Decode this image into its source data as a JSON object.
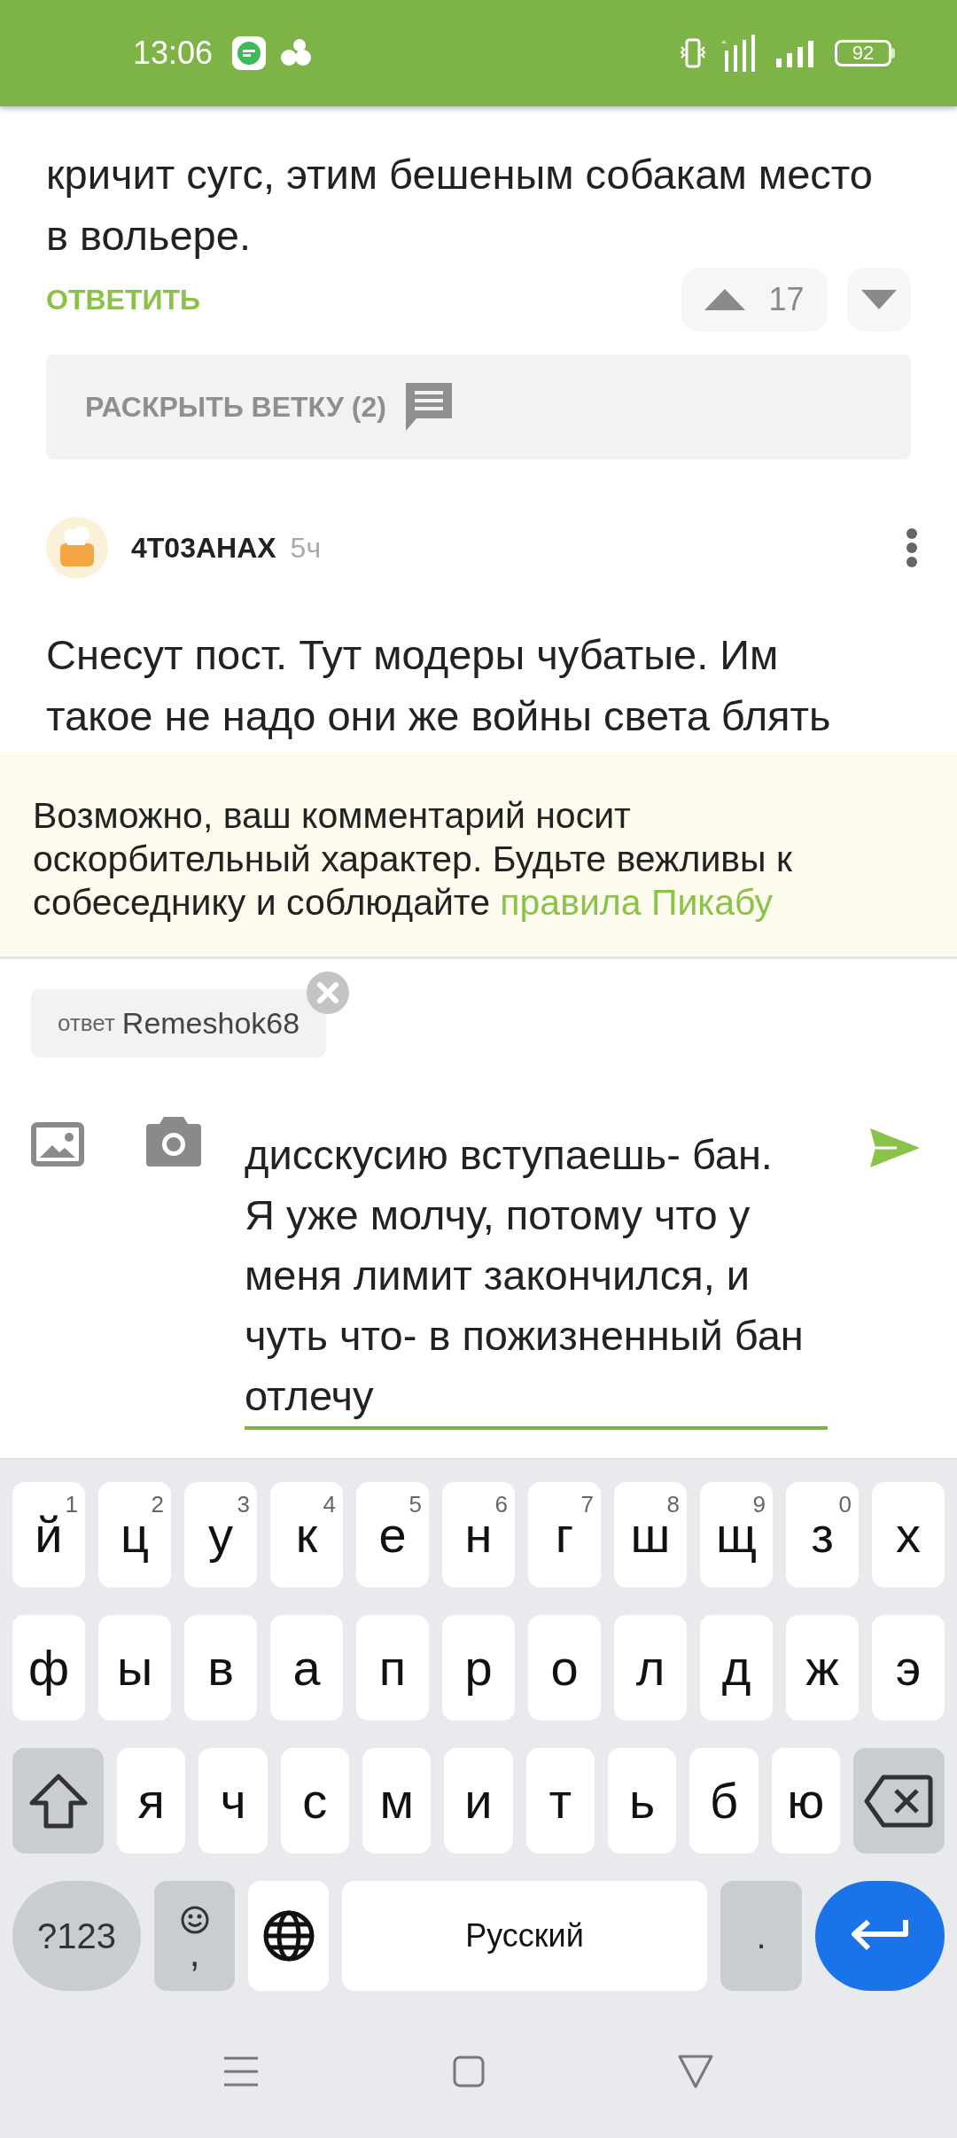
{
  "status_bar": {
    "time": "13:06",
    "battery": "92"
  },
  "previous_comment": {
    "text_lines": [
      "кричит сугс, этим бешеным собакам место",
      "в вольере."
    ],
    "reply_label": "ОТВЕТИТЬ",
    "score": "17",
    "expand_label": "РАСКРЫТЬ ВЕТКУ (2)"
  },
  "comment": {
    "author": "4T03AHAX",
    "age": "5ч",
    "text_lines": [
      "Снесут пост. Тут модеры чубатые. Им",
      "такое не надо они же войны света блять"
    ]
  },
  "warning": {
    "lines": [
      "Возможно, ваш комментарий носит",
      "оскорбительный характер. Будьте вежливы к",
      "собеседнику и соблюдайте "
    ],
    "link": "правила Пикабу"
  },
  "reply_chip": {
    "prefix": "ответ",
    "user": "Remeshok68"
  },
  "composer": {
    "value_lines": [
      "дисскусию вступаешь- бан.",
      "Я уже молчу, потому что у",
      "меня лимит закончился, и",
      "чуть что- в пожизненный бан",
      "отлечу"
    ]
  },
  "keyboard": {
    "row_1": [
      {
        "kind": "letter",
        "label": "й",
        "hint": "1"
      },
      {
        "kind": "letter",
        "label": "ц",
        "hint": "2"
      },
      {
        "kind": "letter",
        "label": "у",
        "hint": "3"
      },
      {
        "kind": "letter",
        "label": "к",
        "hint": "4"
      },
      {
        "kind": "letter",
        "label": "е",
        "hint": "5"
      },
      {
        "kind": "letter",
        "label": "н",
        "hint": "6"
      },
      {
        "kind": "letter",
        "label": "г",
        "hint": "7"
      },
      {
        "kind": "letter",
        "label": "ш",
        "hint": "8"
      },
      {
        "kind": "letter",
        "label": "щ",
        "hint": "9"
      },
      {
        "kind": "letter",
        "label": "з",
        "hint": "0"
      },
      {
        "kind": "letter",
        "label": "х"
      }
    ],
    "row_2": [
      {
        "kind": "letter",
        "label": "ф"
      },
      {
        "kind": "letter",
        "label": "ы"
      },
      {
        "kind": "letter",
        "label": "в"
      },
      {
        "kind": "letter",
        "label": "а"
      },
      {
        "kind": "letter",
        "label": "п"
      },
      {
        "kind": "letter",
        "label": "р"
      },
      {
        "kind": "letter",
        "label": "о"
      },
      {
        "kind": "letter",
        "label": "л"
      },
      {
        "kind": "letter",
        "label": "д"
      },
      {
        "kind": "letter",
        "label": "ж"
      },
      {
        "kind": "letter",
        "label": "э"
      }
    ],
    "row_3": [
      {
        "kind": "shift"
      },
      {
        "kind": "letter",
        "label": "я"
      },
      {
        "kind": "letter",
        "label": "ч"
      },
      {
        "kind": "letter",
        "label": "с"
      },
      {
        "kind": "letter",
        "label": "м"
      },
      {
        "kind": "letter",
        "label": "и"
      },
      {
        "kind": "letter",
        "label": "т"
      },
      {
        "kind": "letter",
        "label": "ь"
      },
      {
        "kind": "letter",
        "label": "б"
      },
      {
        "kind": "letter",
        "label": "ю"
      },
      {
        "kind": "backspace"
      }
    ],
    "bottom_row": [
      {
        "kind": "symbols",
        "label": "?123"
      },
      {
        "kind": "emoji",
        "label": ","
      },
      {
        "kind": "globe"
      },
      {
        "kind": "space",
        "label": "Русский"
      },
      {
        "kind": "period",
        "label": "."
      },
      {
        "kind": "enter"
      }
    ]
  }
}
